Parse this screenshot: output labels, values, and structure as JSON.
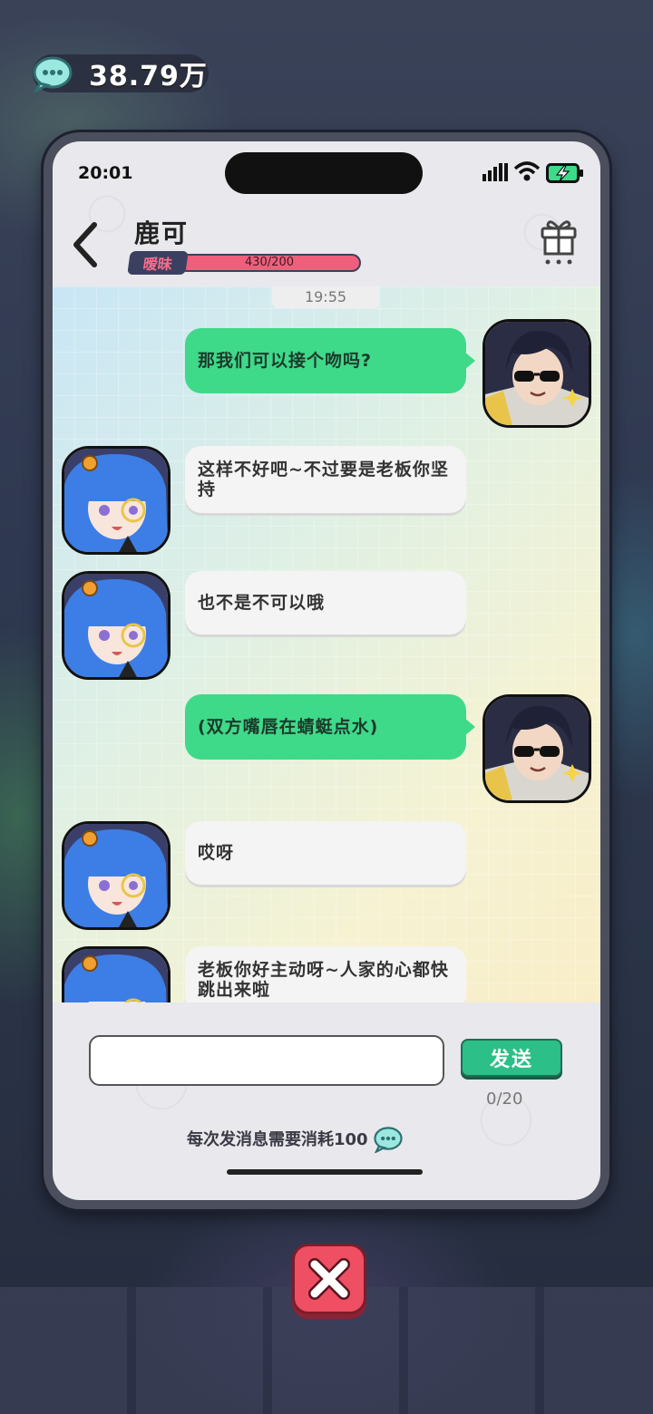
{
  "currency": {
    "icon": "chat-coin-icon",
    "amount": "38.79万"
  },
  "status_bar": {
    "time": "20:01"
  },
  "header": {
    "contact_name": "鹿可",
    "affinity_label": "暧昧",
    "affinity_value": "430/200",
    "affinity_fill_fraction": 1.0
  },
  "chat": {
    "timestamp": "19:55",
    "messages": [
      {
        "sender": "me",
        "text": "那我们可以接个吻吗?"
      },
      {
        "sender": "her",
        "text": "这样不好吧~不过要是老板你坚持"
      },
      {
        "sender": "her",
        "text": "也不是不可以哦"
      },
      {
        "sender": "me",
        "text": "(双方嘴唇在蜻蜓点水)"
      },
      {
        "sender": "her",
        "text": "哎呀"
      },
      {
        "sender": "her",
        "text": "老板你好主动呀~人家的心都快跳出来啦"
      }
    ]
  },
  "composer": {
    "input_value": "",
    "input_placeholder": "",
    "send_label": "发送",
    "char_count": "0/20",
    "cost_note": "每次发消息需要消耗100"
  },
  "colors": {
    "my_bubble": "#3fd98a",
    "her_bubble": "#f4f4f4",
    "affinity_fill": "#ef5f7c",
    "send_button": "#2cbf87",
    "close_button": "#ef4f62"
  }
}
